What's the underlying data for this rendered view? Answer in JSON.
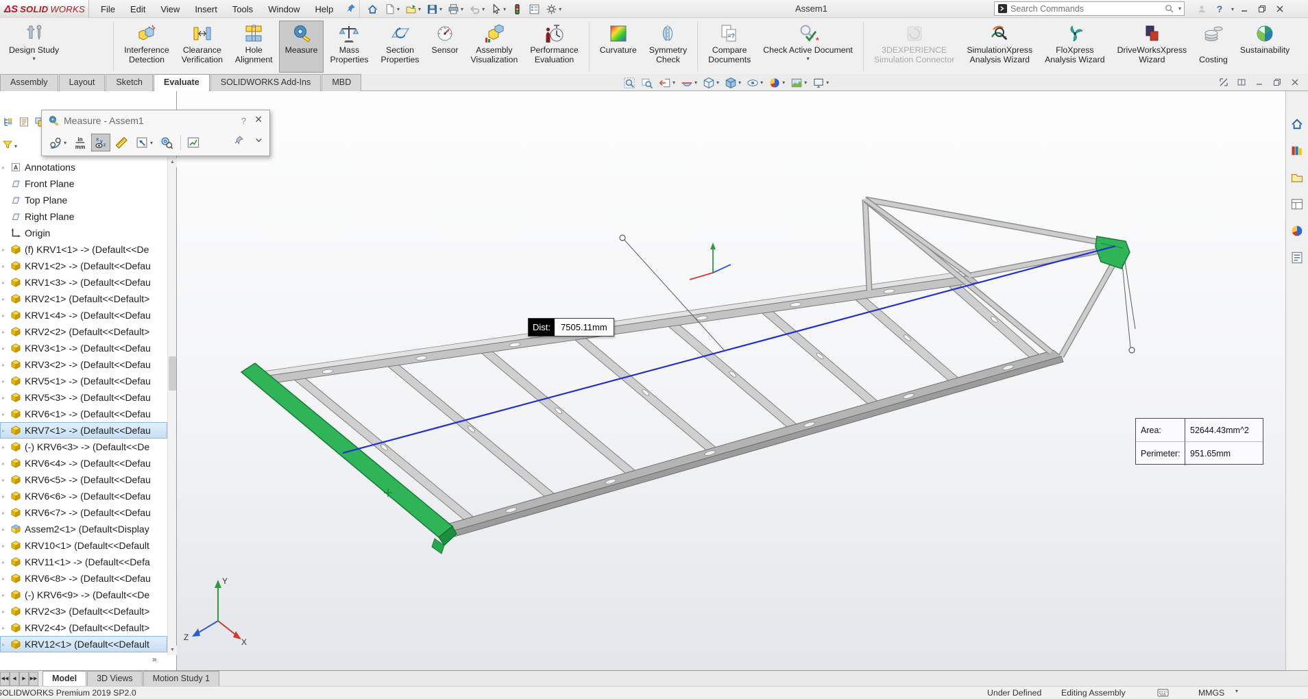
{
  "titlebar": {
    "logo_mark": "ΔS",
    "logo_solid": "SOLID",
    "logo_works": "WORKS",
    "menus": [
      "File",
      "Edit",
      "View",
      "Insert",
      "Tools",
      "Window",
      "Help"
    ],
    "quick_access": [
      {
        "name": "home",
        "caret": false
      },
      {
        "name": "new-document",
        "caret": true
      },
      {
        "name": "open",
        "caret": true
      },
      {
        "name": "save",
        "caret": true
      },
      {
        "name": "print",
        "caret": true
      },
      {
        "name": "undo",
        "caret": true,
        "disabled": true
      },
      {
        "name": "select",
        "caret": true
      },
      {
        "name": "rebuild",
        "caret": false
      },
      {
        "name": "options-list",
        "caret": false
      },
      {
        "name": "settings",
        "caret": true
      }
    ],
    "document_title": "Assem1",
    "search_placeholder": "Search Commands"
  },
  "ribbon": {
    "items": [
      {
        "name": "design-study",
        "label": "Design Study",
        "caret": true,
        "sep_after": true,
        "gap_after": true
      },
      {
        "name": "interference-detection",
        "label": "Interference\nDetection"
      },
      {
        "name": "clearance-verification",
        "label": "Clearance\nVerification"
      },
      {
        "name": "hole-alignment",
        "label": "Hole\nAlignment"
      },
      {
        "name": "measure",
        "label": "Measure",
        "active": true
      },
      {
        "name": "mass-properties",
        "label": "Mass\nProperties"
      },
      {
        "name": "section-properties",
        "label": "Section\nProperties"
      },
      {
        "name": "sensor",
        "label": "Sensor"
      },
      {
        "name": "assembly-visualization",
        "label": "Assembly\nVisualization"
      },
      {
        "name": "performance-evaluation",
        "label": "Performance\nEvaluation",
        "sep_after": true
      },
      {
        "name": "curvature",
        "label": "Curvature"
      },
      {
        "name": "symmetry-check",
        "label": "Symmetry\nCheck",
        "sep_after": true
      },
      {
        "name": "compare-documents",
        "label": "Compare\nDocuments"
      },
      {
        "name": "check-active-document",
        "label": "Check Active Document",
        "caret": true,
        "sep_after": true
      },
      {
        "name": "3dexperience-connector",
        "label": "3DEXPERIENCE\nSimulation Connector",
        "disabled": true
      },
      {
        "name": "simulationxpress",
        "label": "SimulationXpress\nAnalysis Wizard"
      },
      {
        "name": "floxpress",
        "label": "FloXpress\nAnalysis Wizard"
      },
      {
        "name": "driveworksxpress",
        "label": "DriveWorksXpress\nWizard"
      },
      {
        "name": "costing",
        "label": "\nCosting"
      },
      {
        "name": "sustainability",
        "label": "Sustainability"
      }
    ]
  },
  "command_tabs": {
    "tabs": [
      "Assembly",
      "Layout",
      "Sketch",
      "Evaluate",
      "SOLIDWORKS Add-Ins",
      "MBD"
    ],
    "active": "Evaluate"
  },
  "headsup": {
    "tools": [
      {
        "name": "zoom-fit",
        "caret": false
      },
      {
        "name": "zoom-area",
        "caret": false
      },
      {
        "name": "previous-view",
        "caret": true
      },
      {
        "name": "section-view",
        "caret": true
      },
      {
        "name": "view-orientation",
        "caret": true
      },
      {
        "name": "display-style",
        "caret": true
      },
      {
        "name": "hide-show-items",
        "caret": true
      },
      {
        "name": "edit-appearance",
        "caret": true
      },
      {
        "name": "apply-scene",
        "caret": true
      },
      {
        "name": "view-settings",
        "caret": true
      }
    ]
  },
  "measure_dialog": {
    "title": "Measure - Assem1",
    "help_label": "?",
    "close_label": "✕",
    "tools": [
      {
        "name": "arc-measure",
        "caret": true
      },
      {
        "name": "units-in-mm"
      },
      {
        "name": "show-xyz",
        "active": true
      },
      {
        "name": "measure-caliper"
      },
      {
        "name": "point-to-point",
        "caret": true
      },
      {
        "name": "measure-history"
      },
      {
        "name": "trend-graph",
        "divider_before": true
      }
    ]
  },
  "feature_tree": {
    "items": [
      {
        "label": "Annotations",
        "icon": "annotations",
        "caret": true
      },
      {
        "label": "Front Plane",
        "icon": "plane"
      },
      {
        "label": "Top Plane",
        "icon": "plane"
      },
      {
        "label": "Right Plane",
        "icon": "plane"
      },
      {
        "label": "Origin",
        "icon": "origin"
      },
      {
        "label": "(f) KRV1<1> -> (Default<<De",
        "icon": "part",
        "caret": true
      },
      {
        "label": "KRV1<2> -> (Default<<Defau",
        "icon": "part",
        "caret": true
      },
      {
        "label": "KRV1<3> -> (Default<<Defau",
        "icon": "part",
        "caret": true
      },
      {
        "label": "KRV2<1> (Default<<Default>",
        "icon": "part",
        "caret": true
      },
      {
        "label": "KRV1<4> -> (Default<<Defau",
        "icon": "part",
        "caret": true
      },
      {
        "label": "KRV2<2> (Default<<Default>",
        "icon": "part",
        "caret": true
      },
      {
        "label": "KRV3<1> -> (Default<<Defau",
        "icon": "part",
        "caret": true
      },
      {
        "label": "KRV3<2> -> (Default<<Defau",
        "icon": "part",
        "caret": true
      },
      {
        "label": "KRV5<1> -> (Default<<Defau",
        "icon": "part",
        "caret": true
      },
      {
        "label": "KRV5<3> -> (Default<<Defau",
        "icon": "part",
        "caret": true
      },
      {
        "label": "KRV6<1> -> (Default<<Defau",
        "icon": "part",
        "caret": true
      },
      {
        "label": "KRV7<1> -> (Default<<Defau",
        "icon": "part",
        "caret": true,
        "selected": true
      },
      {
        "label": "(-) KRV6<3> -> (Default<<De",
        "icon": "part",
        "caret": true
      },
      {
        "label": "KRV6<4> -> (Default<<Defau",
        "icon": "part",
        "caret": true
      },
      {
        "label": "KRV6<5> -> (Default<<Defau",
        "icon": "part",
        "caret": true
      },
      {
        "label": "KRV6<6> -> (Default<<Defau",
        "icon": "part",
        "caret": true
      },
      {
        "label": "KRV6<7> -> (Default<<Defau",
        "icon": "part",
        "caret": true
      },
      {
        "label": "Assem2<1> (Default<Display",
        "icon": "assembly",
        "caret": true
      },
      {
        "label": "KRV10<1> (Default<<Default",
        "icon": "part",
        "caret": true
      },
      {
        "label": "KRV11<1> -> (Default<<Defa",
        "icon": "part",
        "caret": true
      },
      {
        "label": "KRV6<8> -> (Default<<Defau",
        "icon": "part",
        "caret": true
      },
      {
        "label": "(-) KRV6<9> -> (Default<<De",
        "icon": "part",
        "caret": true
      },
      {
        "label": "KRV2<3> (Default<<Default>",
        "icon": "part",
        "caret": true
      },
      {
        "label": "KRV2<4> (Default<<Default>",
        "icon": "part",
        "caret": true
      },
      {
        "label": "KRV12<1> (Default<<Default",
        "icon": "part",
        "caret": true,
        "selected": true
      }
    ]
  },
  "viewport": {
    "dist_label": "Dist:",
    "dist_value": "7505.11mm",
    "area_label": "Area:",
    "area_value": "52644.43mm^2",
    "perimeter_label": "Perimeter:",
    "perimeter_value": "951.65mm",
    "triad": {
      "x": "X",
      "y": "Y",
      "z": "Z"
    },
    "colors": {
      "selection_green": "#2fb457",
      "measure_blue": "#2230d0",
      "steel": "#c6c6c6"
    }
  },
  "bottom_bar": {
    "tabs": [
      "Model",
      "3D Views",
      "Motion Study 1"
    ],
    "active": "Model"
  },
  "statusbar": {
    "app_version": "SOLIDWORKS Premium 2019 SP2.0",
    "constraint_status": "Under Defined",
    "mode": "Editing Assembly",
    "units": "MMGS"
  },
  "taskpane": {
    "tabs": [
      "solidworks-resources",
      "design-library",
      "file-explorer",
      "view-palette",
      "appearances-scenes",
      "custom-properties"
    ]
  }
}
